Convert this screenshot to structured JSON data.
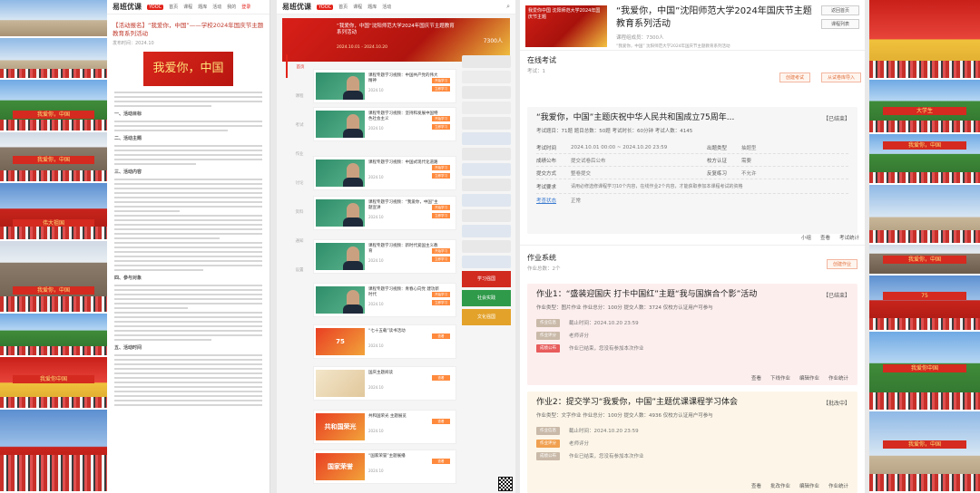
{
  "left_photos": [
    {
      "banner": ""
    },
    {
      "banner": ""
    },
    {
      "banner": "我爱你，中国"
    },
    {
      "banner": "我爱你，中国"
    },
    {
      "banner": "伟大祖国"
    },
    {
      "banner": "我爱你，中国"
    },
    {
      "banner": ""
    },
    {
      "banner": "我爱你中国"
    },
    {
      "banner": ""
    }
  ],
  "right_photos": [
    {
      "banner": ""
    },
    {
      "banner": "大学生"
    },
    {
      "banner": "我爱你，中国"
    },
    {
      "banner": ""
    },
    {
      "banner": "我爱你，中国"
    },
    {
      "banner": "我爱你，中国"
    },
    {
      "banner": "75"
    },
    {
      "banner": "我爱你中国"
    },
    {
      "banner": "我爱你，中国"
    }
  ],
  "article": {
    "logo": "易班优课",
    "logo_tag": "YOOC",
    "nav": [
      "首页",
      "课程",
      "题库",
      "活动",
      "我的",
      "登录"
    ],
    "title": "【活动报名】“我爱你，中国”——学校2024年国庆节主题教育系列活动",
    "meta": "发布时间：2024.10",
    "hero_text": "我爱你，中国",
    "headings": [
      "一、活动目标",
      "二、活动主题",
      "三、活动内容",
      "四、参与对象",
      "五、活动时间"
    ]
  },
  "course": {
    "logo": "易班优课",
    "logo_tag": "YOOC",
    "hero_title": "“我爱你，中国”沈阳师范大学2024年国庆节主题教育系列活动",
    "hero_sub": "2024.10.01 - 2024.10.20",
    "hero_count": "7300人",
    "sidebar": [
      "首页",
      "课程",
      "考试",
      "作业",
      "讨论",
      "资料",
      "通知",
      "设置"
    ],
    "items": [
      {
        "title": "课程专题学习视频：中国共产党的伟大精神",
        "meta": "2024.10",
        "btn": "开始学习",
        "btn2": "立即学习",
        "thumb": "video"
      },
      {
        "title": "课程专题学习视频：坚持和发展中国特色社会主义",
        "meta": "2024.10",
        "btn": "开始学习",
        "btn2": "立即学习",
        "thumb": "video"
      },
      {
        "title": "课程专题学习视频：中国式现代化道路",
        "meta": "2024.10",
        "btn": "开始学习",
        "btn2": "立即学习",
        "thumb": "video"
      },
      {
        "title": "课程专题学习视频：“我爱你，中国”主题宣讲",
        "meta": "2024.10",
        "btn": "开始学习",
        "btn2": "立即学习",
        "thumb": "video"
      },
      {
        "title": "课程专题学习视频：新时代爱国主义教育",
        "meta": "2024.10",
        "btn": "开始学习",
        "btn2": "立即学习",
        "thumb": "video"
      },
      {
        "title": "课程专题学习视频：青春心向党 建功新时代",
        "meta": "2024.10",
        "btn": "开始学习",
        "btn2": "立即学习",
        "thumb": "video"
      },
      {
        "title": "“七十五载”读书活动",
        "meta": "2024.10",
        "btn": "查看",
        "btn2": "",
        "thumb": "festive",
        "thumb_label": "75"
      },
      {
        "title": "国庆主题阅读",
        "meta": "2024.10",
        "btn": "查看",
        "btn2": "",
        "thumb": "cream",
        "thumb_label": ""
      },
      {
        "title": "共和国荣光 主题展览",
        "meta": "2024.10",
        "btn": "查看",
        "btn2": "",
        "thumb": "festive",
        "thumb_label": "共和国荣光"
      },
      {
        "title": "“国家荣誉”主题展播",
        "meta": "2024.10",
        "btn": "查看",
        "btn2": "",
        "thumb": "festive",
        "thumb_label": "国家荣誉"
      }
    ],
    "right_ads": [
      "学习强国",
      "社会实践",
      "文化强国"
    ]
  },
  "exam": {
    "head_img_text": "我爱你中国 沈阳师范大学2024年国庆节主题",
    "title": "“我爱你，中国”沈阳师范大学2024年国庆节主题教育系列活动",
    "meta": "课程组成员：7300人",
    "sub": "“我爱你，中国” 沈阳师范大学2024年国庆节主题教育系列活动",
    "btn_tag": "返回首页",
    "btn_course": "课程列表",
    "online_exam": {
      "title": "在线考试",
      "sub": "考试：1",
      "create_btn": "创建考试",
      "import_btn": "从试卷库导入"
    },
    "exam_card": {
      "title": "“我爱你，中国”主题庆祝中华人民共和国成立75周年...",
      "status": "【已结束】",
      "counts": "考试题目：71题    题目总数：50题    考试时长：60分钟    考试人数：4145",
      "rows": [
        {
          "l1": "考试时间",
          "v1": "2024.10.01 00:00 ~ 2024.10.20 23:59",
          "l2": "出题类型",
          "v2": "抽题型"
        },
        {
          "l1": "成绩公布",
          "v1": "提交试卷后公布",
          "l2": "校方认证",
          "v2": "需要"
        },
        {
          "l1": "提交方式",
          "v1": "整卷提交",
          "l2": "反复练习",
          "v2": "不允许"
        },
        {
          "l1": "考试要求",
          "v1": "请用必修选修课程学习10个内容，在线作业2个内容，才能获取参加本课程考试的资格",
          "l2": "",
          "v2": ""
        },
        {
          "l1": "考查状态",
          "v1": "正常",
          "l2": "",
          "v2": ""
        }
      ],
      "actions": [
        "小组",
        "查看",
        "考试统计"
      ]
    },
    "homework": {
      "title": "作业系统",
      "sub": "作业总数：2个",
      "create_btn": "创建作业"
    },
    "hw1": {
      "title": "作业1：“盛装迎国庆 打卡中国红”主题“我与国旗合个影”活动",
      "status": "【已结束】",
      "line": "作业类型：图片作业    作业总分：100分    提交人数：3724    仅校方认证用户可参与",
      "chips": [
        "作业信息",
        "作业评分",
        "成绩公布"
      ],
      "deadline": "截止时间：2024.10.20 23:59",
      "grading": "老师评分",
      "result": "作业已结束，您没有参加本次作业",
      "actions": [
        "查看",
        "下线作业",
        "编辑作业",
        "作业统计"
      ]
    },
    "hw2": {
      "title": "作业2：提交学习“我爱你，中国”主题优课课程学习体会",
      "status": "【批改中】",
      "line": "作业类型：文字作业    作业总分：100分    提交人数：4936    仅校方认证用户可参与",
      "chips": [
        "作业信息",
        "作业评分",
        "成绩公布"
      ],
      "deadline": "截止时间：2024.10.20 23:59",
      "grading": "老师评分",
      "result": "作业已结束，您没有参加本次作业",
      "actions": [
        "查看",
        "批改作业",
        "编辑作业",
        "作业统计"
      ]
    }
  }
}
